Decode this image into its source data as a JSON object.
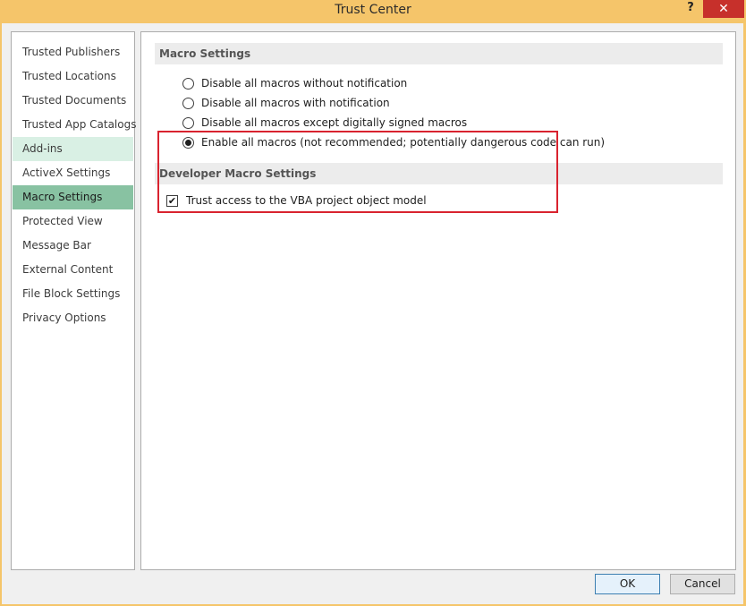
{
  "window": {
    "title": "Trust Center",
    "help_label": "?",
    "close_label": "✕"
  },
  "sidebar": {
    "items": [
      {
        "label": "Trusted Publishers"
      },
      {
        "label": "Trusted Locations"
      },
      {
        "label": "Trusted Documents"
      },
      {
        "label": "Trusted App Catalogs"
      },
      {
        "label": "Add-ins"
      },
      {
        "label": "ActiveX Settings"
      },
      {
        "label": "Macro Settings"
      },
      {
        "label": "Protected View"
      },
      {
        "label": "Message Bar"
      },
      {
        "label": "External Content"
      },
      {
        "label": "File Block Settings"
      },
      {
        "label": "Privacy Options"
      }
    ],
    "hovered_item": "Add-ins",
    "selected_item": "Macro Settings"
  },
  "macro_settings": {
    "header": "Macro Settings",
    "options": [
      {
        "label": "Disable all macros without notification",
        "checked": false
      },
      {
        "label": "Disable all macros with notification",
        "checked": false
      },
      {
        "label": "Disable all macros except digitally signed macros",
        "checked": false
      },
      {
        "label": "Enable all macros (not recommended; potentially dangerous code can run)",
        "checked": true
      }
    ]
  },
  "developer_settings": {
    "header": "Developer Macro Settings",
    "trust_vba_label": "Trust access to the VBA project object model",
    "trust_vba_checked": true
  },
  "buttons": {
    "ok_label": "OK",
    "cancel_label": "Cancel"
  },
  "colors": {
    "titlebar": "#f5c56a",
    "close_button": "#c7302b",
    "sidebar_selected": "#88c2a2",
    "sidebar_hover": "#d9f0e4",
    "highlight_box": "#d9232f"
  }
}
